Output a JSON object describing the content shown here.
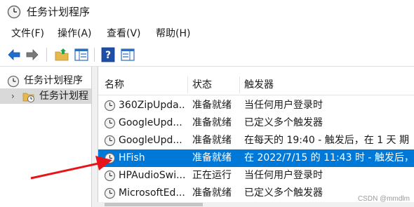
{
  "window": {
    "title": "任务计划程序"
  },
  "menu": [
    "文件(F)",
    "操作(A)",
    "查看(V)",
    "帮助(H)"
  ],
  "toolbar": {
    "buttons": [
      "back-arrow-icon",
      "forward-arrow-icon",
      "folder-up-icon",
      "show-hide-tree-icon",
      "help-icon",
      "show-hide-action-pane-icon"
    ]
  },
  "tree": {
    "items": [
      {
        "label": "任务计划程序"
      },
      {
        "label": "任务计划程"
      }
    ]
  },
  "list": {
    "columns": [
      "名称",
      "状态",
      "触发器"
    ],
    "rows": [
      {
        "name": "360ZipUpda...",
        "status": "准备就绪",
        "trigger": "当任何用户登录时"
      },
      {
        "name": "GoogleUpd...",
        "status": "准备就绪",
        "trigger": "已定义多个触发器"
      },
      {
        "name": "GoogleUpd...",
        "status": "准备就绪",
        "trigger": "在每天的 19:40 - 触发后，在 1 天 期"
      },
      {
        "name": "HFish",
        "status": "准备就绪",
        "trigger": "在 2022/7/15 的 11:43 时 - 触发后，"
      },
      {
        "name": "HPAudioSwi...",
        "status": "正在运行",
        "trigger": "当任何用户登录时"
      },
      {
        "name": "MicrosoftEd...",
        "status": "准备就绪",
        "trigger": "已定义多个触发器"
      }
    ],
    "selected_index": 3
  },
  "watermark": "CSDN @mmdlm",
  "colors": {
    "selection": "#0078d7",
    "arrow": "#e8141c",
    "toolbar_blue": "#1e6fd0",
    "folder": "#e8b94a"
  }
}
